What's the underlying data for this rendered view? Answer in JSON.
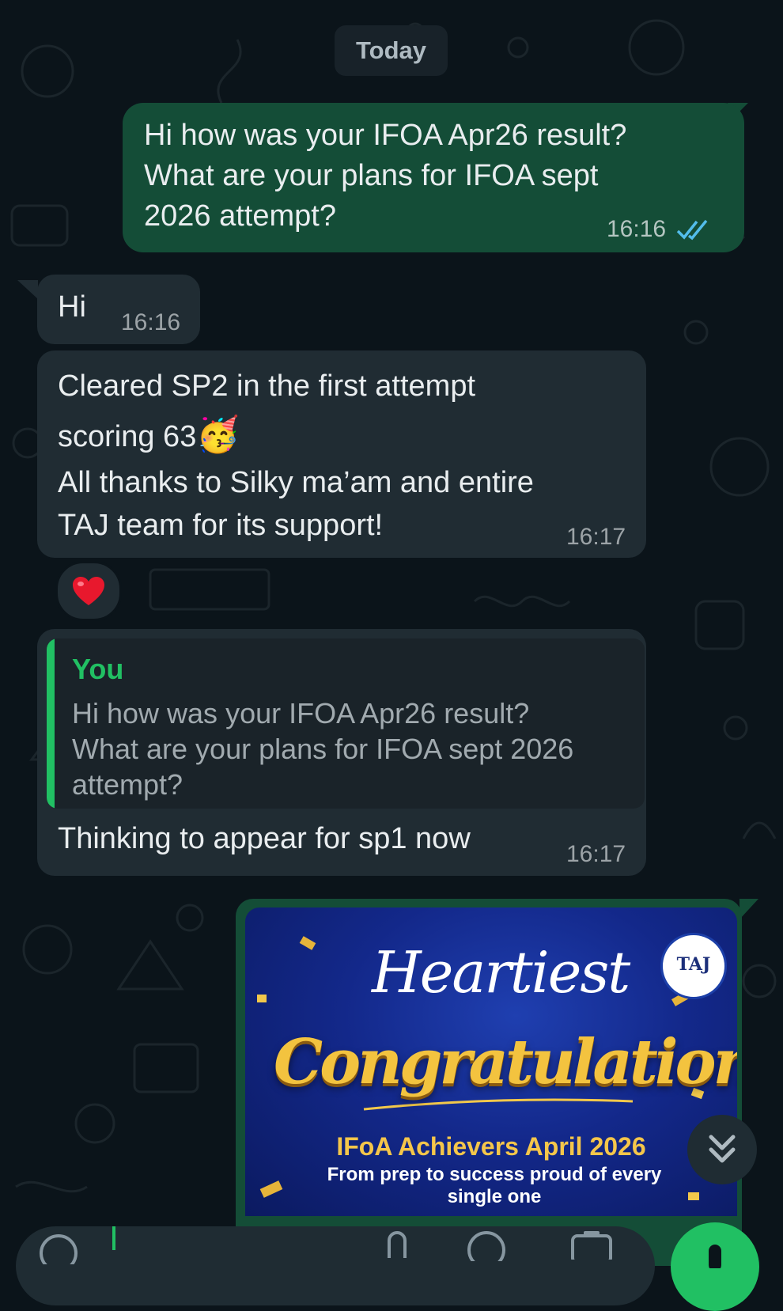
{
  "date_divider": "Today",
  "messages": {
    "outgoing_question": {
      "line1": "Hi how was your IFOA Apr26 result?",
      "line2": "What are your plans for IFOA sept",
      "line3": "2026 attempt?",
      "time": "16:16",
      "status": "read"
    },
    "incoming_hi": {
      "text": "Hi",
      "time": "16:16"
    },
    "incoming_cleared": {
      "line1": "Cleared SP2 in the first attempt",
      "line2": "scoring 63",
      "emoji": "🥳",
      "line3": "All thanks to Silky ma’am and entire",
      "line4": "TAJ team for its support!",
      "time": "16:17",
      "reaction": "❤️"
    },
    "incoming_reply": {
      "quote_author": "You",
      "quote_line1": "Hi how was your IFOA Apr26 result?",
      "quote_line2": "What are your plans for IFOA sept 2026",
      "quote_line3": "attempt?",
      "text": "Thinking to appear for sp1 now",
      "time": "16:17"
    },
    "outgoing_image": {
      "heading_script": "Heartiest",
      "heading_main": "Congratulations",
      "subtitle": "IFoA Achievers April 2026",
      "tagline_line1": "From prep to success proud of every",
      "tagline_line2": "single one",
      "logo_text": "TAJ"
    }
  },
  "colors": {
    "background": "#0b141a",
    "outgoing_bubble": "#144d37",
    "incoming_bubble": "#202c33",
    "accent": "#21c063",
    "read_ticks": "#53bdeb"
  },
  "icons": [
    "double-check-icon",
    "heart-reaction-icon",
    "scroll-down-icon",
    "emoji-icon",
    "attach-icon",
    "camera-icon",
    "mic-icon"
  ]
}
